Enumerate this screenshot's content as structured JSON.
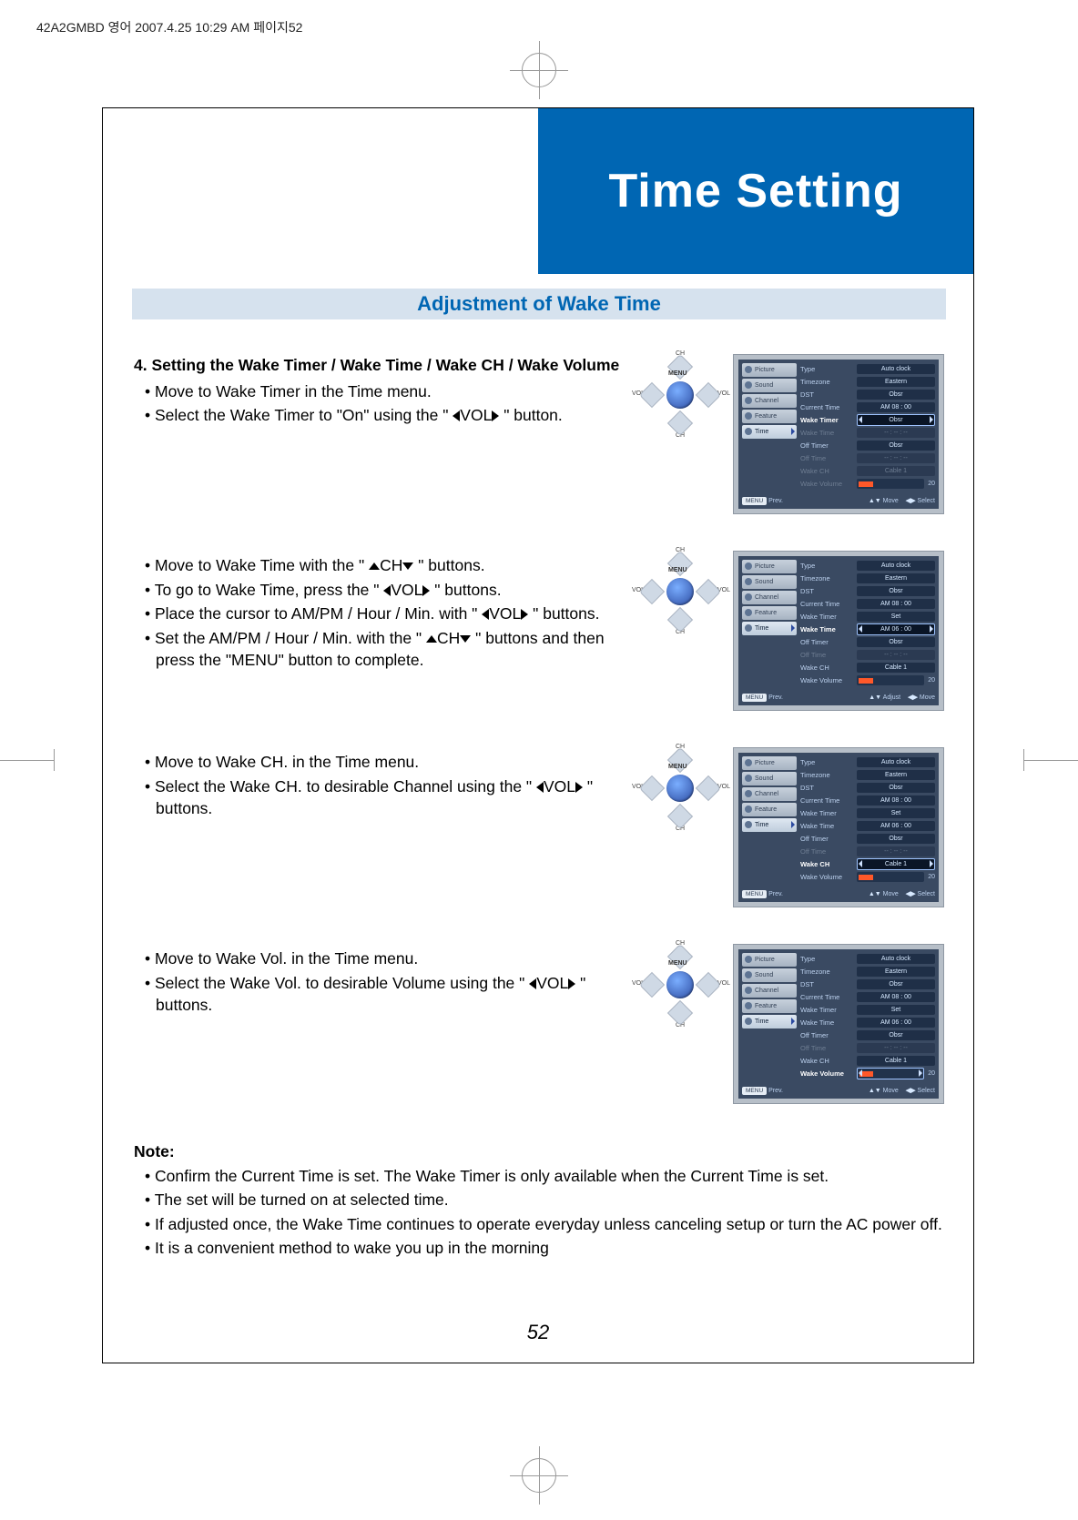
{
  "print_header": "42A2GMBD 영어  2007.4.25 10:29 AM 페이지52",
  "page_title": "Time Setting",
  "section_title": "Adjustment of Wake Time",
  "page_number": "52",
  "remote": {
    "menu": "MENU",
    "up": "CH",
    "down": "CH",
    "left": "VOL",
    "right": "VOL"
  },
  "steps": {
    "s1": {
      "heading": "4. Setting the Wake Timer / Wake Time / Wake CH / Wake Volume",
      "b1": "Move to Wake Timer in the Time menu.",
      "b2_a": "Select the Wake Timer to \"On\" using the \" ",
      "b2_b": "VOL",
      "b2_c": " \" button."
    },
    "s2": {
      "b1_a": "Move to Wake Time with the \" ",
      "b1_b": "CH",
      "b1_c": " \" buttons.",
      "b2_a": "To go to Wake Time, press the \" ",
      "b2_b": "VOL",
      "b2_c": " \" buttons.",
      "b3_a": "Place the cursor to AM/PM / Hour / Min. with \" ",
      "b3_b": "VOL",
      "b3_c": " \" buttons.",
      "b4_a": "Set the AM/PM / Hour / Min. with the \" ",
      "b4_b": "CH",
      "b4_c": " \" buttons and then press the \"MENU\" button to complete."
    },
    "s3": {
      "b1": "Move to Wake CH. in the Time menu.",
      "b2_a": "Select the Wake CH. to desirable Channel using the \" ",
      "b2_b": "VOL",
      "b2_c": " \" buttons."
    },
    "s4": {
      "b1": "Move to Wake Vol. in the Time menu.",
      "b2_a": "Select the Wake Vol. to desirable Volume using the \" ",
      "b2_b": "VOL",
      "b2_c": " \" buttons."
    }
  },
  "note": {
    "title": "Note:",
    "n1": "Confirm the Current Time is set. The Wake Timer is only available when the Current Time is set.",
    "n2": "The set will be turned on at selected time.",
    "n3": "If adjusted once, the Wake Time continues to operate everyday unless canceling setup or turn the AC power off.",
    "n4": "It is a convenient method to wake you up in the morning"
  },
  "osd": {
    "tabs": [
      "Picture",
      "Sound",
      "Channel",
      "Feature",
      "Time"
    ],
    "foot_prev_btn": "MENU",
    "foot_prev": "Prev.",
    "foot_move": "Move",
    "foot_adjust": "Adjust",
    "foot_select": "Select",
    "common": {
      "Type": "Auto clock",
      "Timezone": "Eastern",
      "DST": "Obsr",
      "CurrentTime": "AM 08 : 00",
      "WakeTimer_Set": "Set",
      "WakeTimer_Obsr": "Obsr",
      "WakeTime": "AM 06 : 00",
      "OffTimer": "Obsr",
      "OffTime": "-- : -- : --",
      "WakeCH": "Cable 1",
      "WakeVolNum": "20"
    },
    "labels": {
      "Type": "Type",
      "Timezone": "Timezone",
      "DST": "DST",
      "CurrentTime": "Current Time",
      "WakeTimer": "Wake Timer",
      "WakeTime": "Wake Time",
      "OffTimer": "Off Timer",
      "OffTime": "Off Time",
      "WakeCH": "Wake CH",
      "WakeVolume": "Wake Volume"
    }
  }
}
